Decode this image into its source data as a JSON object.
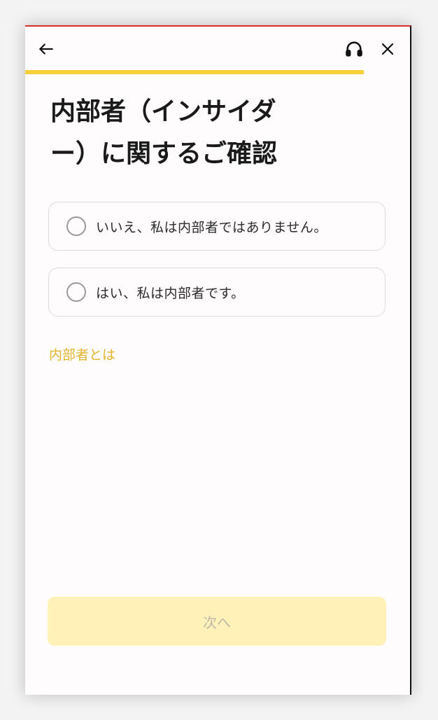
{
  "header": {
    "back_icon": "arrow-left-icon",
    "support_icon": "headphones-icon",
    "close_icon": "close-icon"
  },
  "progress": {
    "fraction": 0.88,
    "color": "#f7cf3b"
  },
  "page": {
    "title_line1": "内部者（インサイダ",
    "title_line2": "ー）に関するご確認"
  },
  "options": [
    {
      "label": "いいえ、私は内部者ではありません。"
    },
    {
      "label": "はい、私は内部者です。"
    }
  ],
  "info_link": "内部者とは",
  "next_button": "次へ",
  "colors": {
    "accent": "#f7cf3b",
    "link": "#e2b42c",
    "disabled_button_bg": "#fff1b8",
    "disabled_button_text": "#bdb8a6"
  }
}
